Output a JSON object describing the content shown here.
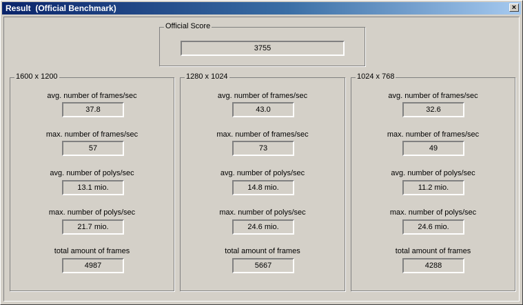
{
  "window": {
    "title": "Result  (Official Benchmark)",
    "close_label": "×"
  },
  "official_score": {
    "legend": "Official Score",
    "value": "3755"
  },
  "resolutions": [
    {
      "legend": "1600 x 1200",
      "stats": [
        {
          "label": "avg. number of frames/sec",
          "value": "37.8"
        },
        {
          "label": "max. number of frames/sec",
          "value": "57"
        },
        {
          "label": "avg. number of polys/sec",
          "value": "13.1 mio."
        },
        {
          "label": "max. number of polys/sec",
          "value": "21.7 mio."
        },
        {
          "label": "total amount of frames",
          "value": "4987"
        }
      ]
    },
    {
      "legend": "1280 x 1024",
      "stats": [
        {
          "label": "avg. number of frames/sec",
          "value": "43.0"
        },
        {
          "label": "max. number of frames/sec",
          "value": "73"
        },
        {
          "label": "avg. number of polys/sec",
          "value": "14.8 mio."
        },
        {
          "label": "max. number of polys/sec",
          "value": "24.6 mio."
        },
        {
          "label": "total amount of frames",
          "value": "5667"
        }
      ]
    },
    {
      "legend": "1024 x 768",
      "stats": [
        {
          "label": "avg. number of frames/sec",
          "value": "32.6"
        },
        {
          "label": "max. number of frames/sec",
          "value": "49"
        },
        {
          "label": "avg. number of polys/sec",
          "value": "11.2 mio."
        },
        {
          "label": "max. number of polys/sec",
          "value": "24.6 mio."
        },
        {
          "label": "total amount of frames",
          "value": "4288"
        }
      ]
    }
  ]
}
